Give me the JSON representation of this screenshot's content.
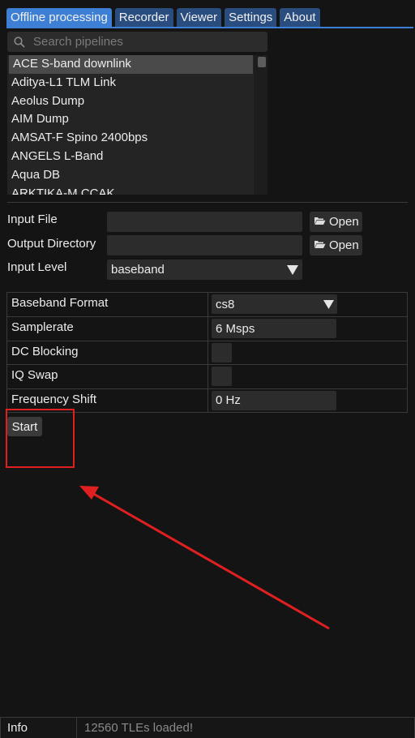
{
  "tabs": [
    {
      "label": "Offline processing",
      "active": true
    },
    {
      "label": "Recorder",
      "active": false
    },
    {
      "label": "Viewer",
      "active": false
    },
    {
      "label": "Settings",
      "active": false
    },
    {
      "label": "About",
      "active": false
    }
  ],
  "search": {
    "placeholder": "Search pipelines",
    "icon": "search-icon"
  },
  "pipelines": {
    "selected_index": 0,
    "items": [
      "ACE S-band downlink",
      "Aditya-L1 TLM Link",
      "Aeolus Dump",
      "AIM Dump",
      "AMSAT-F Spino 2400bps",
      "ANGELS L-Band",
      "Aqua DB",
      "ARKTIKA-M CCAK"
    ]
  },
  "form": {
    "input_file": {
      "label": "Input File",
      "value": "",
      "button": "Open",
      "icon": "folder-open-icon"
    },
    "output_dir": {
      "label": "Output Directory",
      "value": "",
      "button": "Open",
      "icon": "folder-open-icon"
    },
    "input_level": {
      "label": "Input Level",
      "value": "baseband"
    }
  },
  "params": {
    "baseband_format": {
      "label": "Baseband Format",
      "value": "cs8"
    },
    "samplerate": {
      "label": "Samplerate",
      "value": "6 Msps"
    },
    "dc_blocking": {
      "label": "DC Blocking",
      "checked": false
    },
    "iq_swap": {
      "label": "IQ Swap",
      "checked": false
    },
    "frequency_shift": {
      "label": "Frequency Shift",
      "value": "0 Hz"
    }
  },
  "start_label": "Start",
  "status": {
    "label": "Info",
    "message": "12560 TLEs loaded!"
  },
  "colors": {
    "accent": "#3d7fd4",
    "tab": "#2a4d80",
    "annotation": "#e02020",
    "background": "#141414"
  }
}
